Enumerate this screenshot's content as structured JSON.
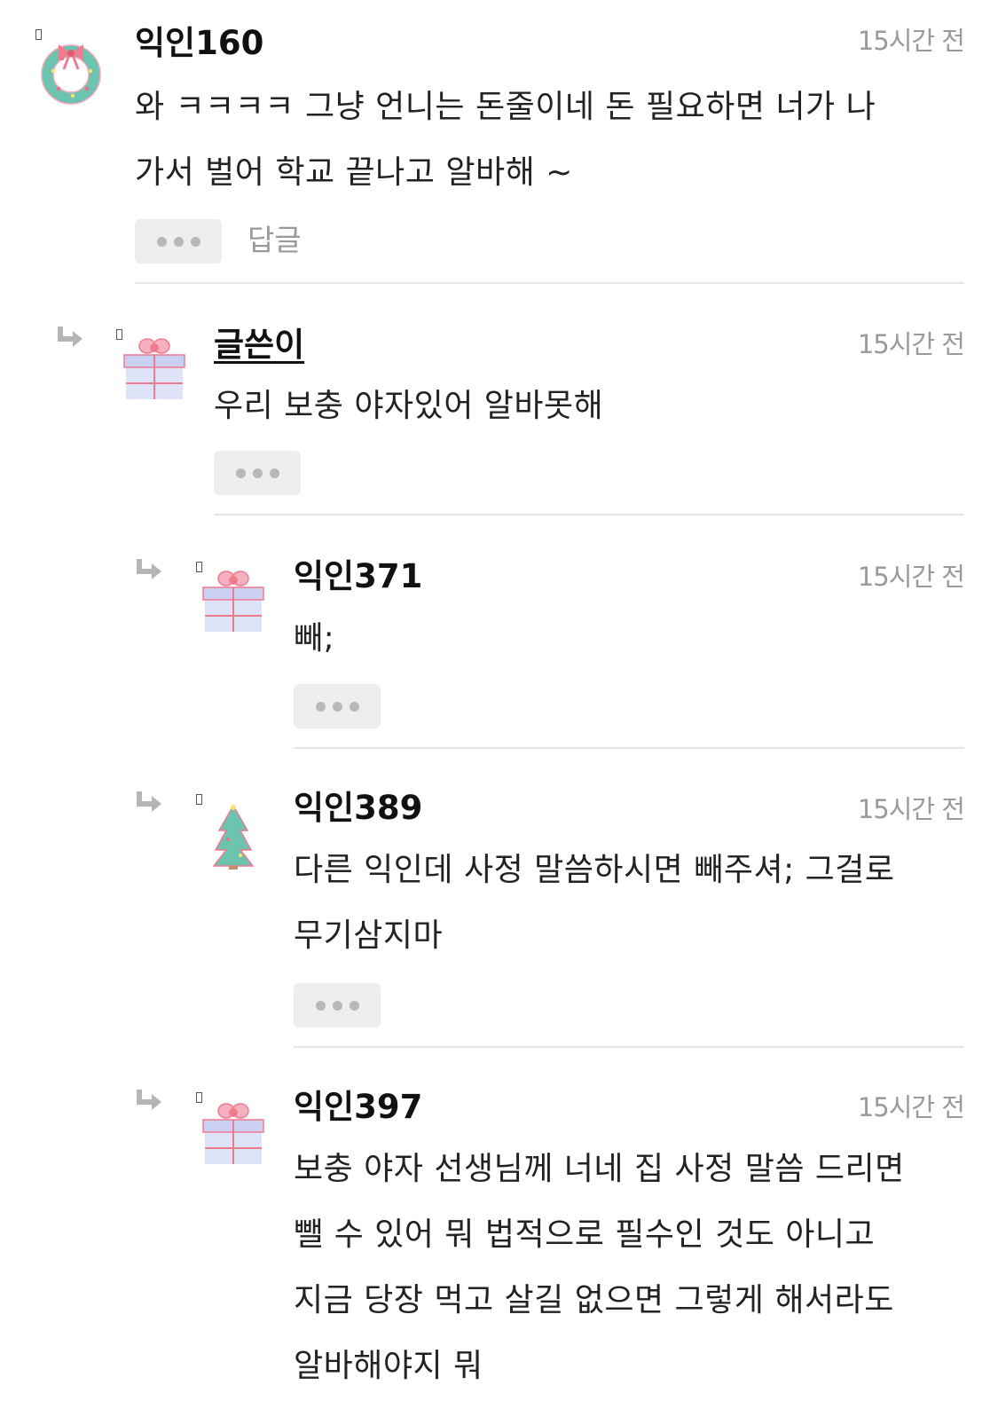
{
  "comments": [
    {
      "nickname": "익인160",
      "time": "15시간 전",
      "lines": [
        "와 ㅋㅋㅋㅋ 그냥 언니는 돈줄이네 돈 필요하면 너가 나",
        "가서 벌어 학교 끝나고 알바해 ~"
      ],
      "reply_label": "답글",
      "avatar": "wreath-icon",
      "is_reply": false
    },
    {
      "nickname": "글쓴이",
      "time": "15시간 전",
      "lines": [
        "우리 보충 야자있어 알바못해"
      ],
      "avatar": "gift-box-icon",
      "is_reply": true
    },
    {
      "nickname": "익인371",
      "time": "15시간 전",
      "lines": [
        "빼;"
      ],
      "avatar": "gift-box-icon",
      "is_reply": true
    },
    {
      "nickname": "익인389",
      "time": "15시간 전",
      "lines": [
        "다른 익인데 사정 말씀하시면 빼주셔; 그걸로",
        "무기삼지마"
      ],
      "avatar": "christmas-tree-icon",
      "is_reply": true
    },
    {
      "nickname": "익인397",
      "time": "15시간 전",
      "lines": [
        "보충 야자 선생님께 너네 집 사정 말씀 드리면",
        "뺄 수 있어 뭐 법적으로 필수인 것도 아니고",
        "지금 당장 먹고 살길 없으면 그렇게 해서라도",
        "알바해야지 뭐"
      ],
      "avatar": "gift-box-icon",
      "is_reply": true
    }
  ],
  "colors": {
    "background": "#ffffff",
    "text": "#222222",
    "muted": "#9a9a9a",
    "button_bg": "#eeeeee",
    "divider": "#e6e6e6"
  }
}
